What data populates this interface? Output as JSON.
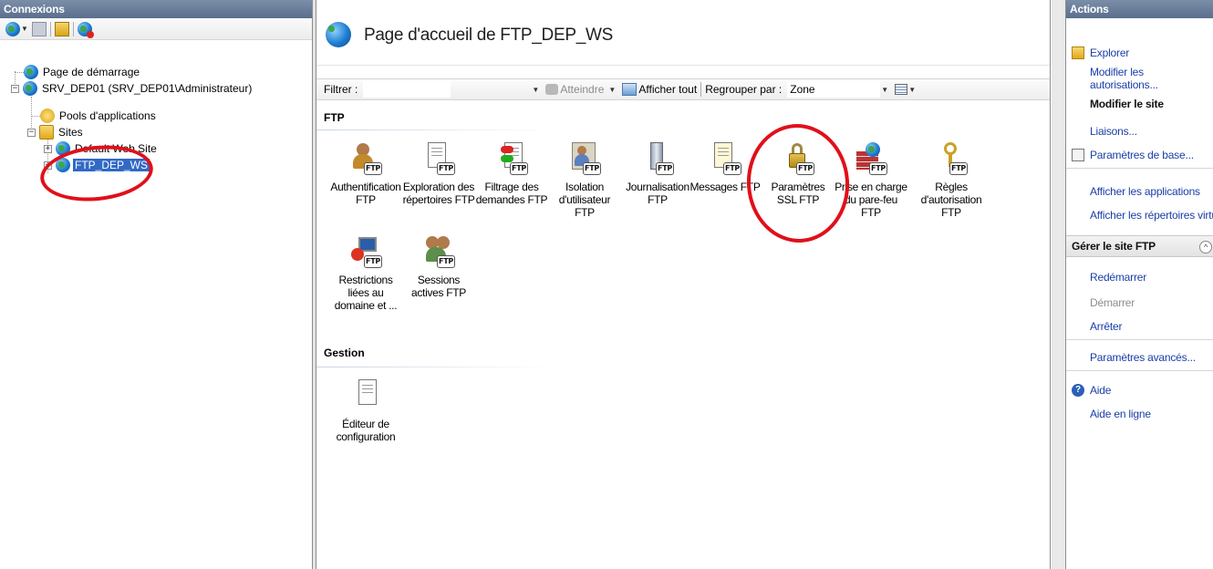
{
  "connections": {
    "title": "Connexions",
    "tree": [
      {
        "label": "Page de démarrage"
      },
      {
        "label": "SRV_DEP01 (SRV_DEP01\\Administrateur)"
      },
      {
        "label": "Pools d'applications"
      },
      {
        "label": "Sites"
      },
      {
        "label": "Default Web Site"
      },
      {
        "label": "FTP_DEP_WS"
      }
    ]
  },
  "main": {
    "title": "Page d'accueil de FTP_DEP_WS",
    "filter": {
      "label": "Filtrer :",
      "value": "",
      "go_label": "Atteindre",
      "show_all_label": "Afficher tout",
      "group_label": "Regrouper par :",
      "group_value": "Zone"
    },
    "sections": [
      {
        "title": "FTP",
        "features": [
          {
            "label": "Authentification FTP",
            "icon": "users-icon"
          },
          {
            "label": "Exploration des répertoires FTP",
            "icon": "browse-icon"
          },
          {
            "label": "Filtrage des demandes FTP",
            "icon": "filter-icon"
          },
          {
            "label": "Isolation d'utilisateur FTP",
            "icon": "user-isolation-icon"
          },
          {
            "label": "Journalisation FTP",
            "icon": "log-icon"
          },
          {
            "label": "Messages FTP",
            "icon": "messages-icon"
          },
          {
            "label": "Paramètres SSL FTP",
            "icon": "lock-icon"
          },
          {
            "label": "Prise en charge du pare-feu FTP",
            "icon": "firewall-icon"
          },
          {
            "label": "Règles d'autorisation FTP",
            "icon": "key-icon"
          },
          {
            "label": "Restrictions liées au domaine et ...",
            "icon": "ip-restriction-icon"
          },
          {
            "label": "Sessions actives FTP",
            "icon": "sessions-icon"
          }
        ]
      },
      {
        "title": "Gestion",
        "features": [
          {
            "label": "Éditeur de configuration",
            "icon": "config-editor-icon"
          }
        ]
      }
    ],
    "badge_text": "FTP"
  },
  "actions": {
    "title": "Actions",
    "explore": "Explorer",
    "edit_permissions": "Modifier les autorisations...",
    "edit_site_header": "Modifier le site",
    "bindings": "Liaisons...",
    "basic_settings": "Paramètres de base...",
    "view_applications": "Afficher les applications",
    "view_virtual_dirs": "Afficher les répertoires virtuels",
    "manage_site_header": "Gérer le site FTP",
    "restart": "Redémarrer",
    "start": "Démarrer",
    "stop": "Arrêter",
    "advanced_settings": "Paramètres avancés...",
    "help": "Aide",
    "online_help": "Aide en ligne"
  },
  "colors": {
    "link": "#1a3ea8",
    "selection": "#3169c6",
    "annotation": "#e0101a",
    "header_band": "#5a6f8e"
  }
}
